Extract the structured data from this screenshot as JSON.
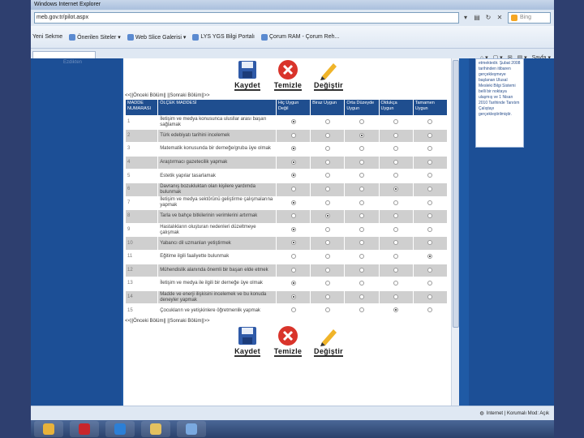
{
  "browser": {
    "title": "Windows Internet Explorer",
    "address": "meb.gov.tr/pilot.aspx",
    "search_placeholder": "Bing",
    "favorites": [
      {
        "label": "Yeni Sekme"
      },
      {
        "label": "Önerilen Siteler ▾"
      },
      {
        "label": "Web Slice Galerisi ▾"
      },
      {
        "label": "LYS YGS Bilgi Portalı"
      },
      {
        "label": "Çorum RAM - Çorum Reh..."
      }
    ],
    "tab_tools": [
      "⌂ ▾",
      "▢ ▾",
      "✉",
      "▤ ▾",
      "Sayfa ▾"
    ]
  },
  "left": {
    "text": "Ezdikten"
  },
  "right": {
    "info": "etmektedir. Şubat 2008 tarihinden itibaren gerçekleşmeye başlanan Ulusal Mesleki Bilgi Sistemi belli bir noktaya ulaşmış ve 1 Nisan 2010 Tarihinde Tanıtım Çalıştayı gerçekleştirilmiştir."
  },
  "actions": {
    "save": "Kaydet",
    "clear": "Temizle",
    "change": "Değiştir"
  },
  "pager": {
    "text": "<<||Önceki Bölüm|| ||Sonraki Bölüm||>>"
  },
  "table": {
    "headers": {
      "num": "MADDE NUMARASI",
      "item": "ÖLÇEK MADDESİ",
      "o1": "Hiç Uygun Değil",
      "o2": "Biraz Uygun",
      "o3": "Orta Düzeyde Uygun",
      "o4": "Oldukça Uygun",
      "o5": "Tamamen Uygun"
    },
    "rows": [
      {
        "num": "1",
        "item": "İletişim ve medya konusunca ulusllar arası başarı sağlamak",
        "sel": 1
      },
      {
        "num": "2",
        "item": "Türk edebiyatı tarihini incelemek",
        "sel": 3
      },
      {
        "num": "3",
        "item": "Matematik konusunda bir derneğe/gruba üye olmak",
        "sel": 1
      },
      {
        "num": "4",
        "item": "Araştırmacı gazetecilik yapmak",
        "sel": 1
      },
      {
        "num": "5",
        "item": "Estetik yapılar tasarlamak",
        "sel": 1
      },
      {
        "num": "6",
        "item": "Davranış bozukluktan olan kişilere yardımda bulunmak",
        "sel": 4
      },
      {
        "num": "7",
        "item": "İletişim ve medya sektörünü geliştirme çalışmalarına yapmak",
        "sel": 1
      },
      {
        "num": "8",
        "item": "Tarla ve bahçe bitkilerinin verimlerini artırmak",
        "sel": 2
      },
      {
        "num": "9",
        "item": "Hastalıkların oluşturan nedenleri düzeltmeye çalışmak",
        "sel": 1
      },
      {
        "num": "10",
        "item": "Yabancı dil uzmanları yetiştirmek",
        "sel": 1
      },
      {
        "num": "11",
        "item": "Eğitime ilgili faaliyette bulunmak",
        "sel": 5
      },
      {
        "num": "12",
        "item": "Mühendislik alanında önemli bir başarı elde etmek",
        "sel": 0
      },
      {
        "num": "13",
        "item": "İletişim ve medya ile ilgili bir derneğe üye olmak",
        "sel": 1
      },
      {
        "num": "14",
        "item": "Madde ve enerji ilişkisini incelemek ve bu konuda deneyler yapmak",
        "sel": 1
      },
      {
        "num": "15",
        "item": "Çocukların ve yetişkinlere öğretmenlik yapmak",
        "sel": 4
      }
    ]
  },
  "status": {
    "text": "Internet | Korumalı Mod: Açık"
  },
  "colors": {
    "header_bg": "#1f4e8f",
    "page_bg": "#1f5aa5",
    "save_icon": "#2f5aa8",
    "clear_icon": "#d9342b",
    "change_icon": "#f0b429"
  },
  "taskbar": {
    "apps": [
      {
        "icon": "windows-explorer-icon",
        "color": "#e8b23a"
      },
      {
        "icon": "acrobat-icon",
        "color": "#c8262c"
      },
      {
        "icon": "internet-explorer-icon",
        "color": "#2c7fd6"
      },
      {
        "icon": "folder-icon",
        "color": "#e3c160"
      },
      {
        "icon": "paint-icon",
        "color": "#7aa9e0"
      }
    ]
  }
}
